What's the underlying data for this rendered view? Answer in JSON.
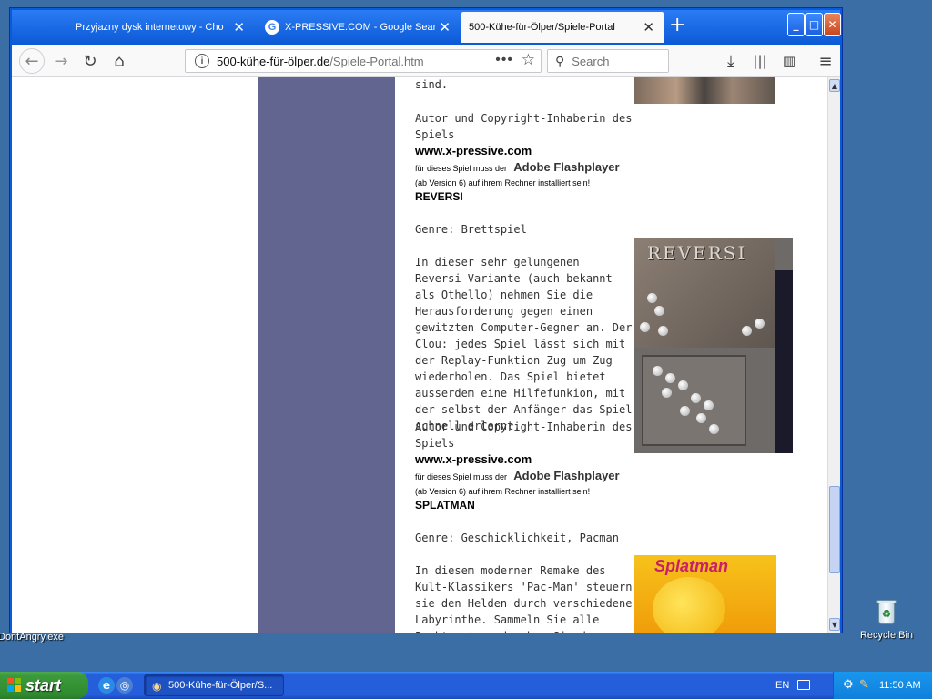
{
  "desktop": {
    "left_icon_label": "DontAngry.exe",
    "recycle_bin_label": "Recycle Bin"
  },
  "browser": {
    "tabs": [
      {
        "title": "Przyjazny dysk internetowy - Cho"
      },
      {
        "title": "X-PRESSIVE.COM - Google Search"
      },
      {
        "title": "500-Kühe-für-Ölper/Spiele-Portal"
      }
    ],
    "url_host": "500-kühe-für-ölper.de",
    "url_path": "/Spiele-Portal.htm",
    "search_placeholder": "Search"
  },
  "page": {
    "top_fragment": "sind.",
    "block1": {
      "author_line": "Autor und Copyright-Inhaberin des Spiels",
      "website": "www.x-pressive.com",
      "flash_prefix": "für dieses Spiel muss der",
      "flash_name": "Adobe Flashplayer",
      "flash_suffix": "(ab Version 6) auf ihrem Rechner installiert sein!"
    },
    "reversi": {
      "heading": "REVERSI",
      "genre": "Genre: Brettspiel",
      "description": "In dieser sehr gelungenen Reversi-Variante (auch bekannt als Othello) nehmen Sie die Herausforderung gegen einen gewitzten Computer-Gegner an. Der Clou: jedes Spiel lässt sich mit der Replay-Funktion Zug um Zug wiederholen. Das Spiel bietet ausserdem eine Hilfefunkion, mit der selbst der Anfänger das Spiel schnell erlernt.",
      "author_line": "Autor und Copyright-Inhaberin des Spiels",
      "website": "www.x-pressive.com",
      "flash_prefix": "für dieses Spiel muss der",
      "flash_name": "Adobe Flashplayer",
      "flash_suffix": "(ab Version 6) auf ihrem Rechner installiert sein!",
      "image_title": "REVERSI"
    },
    "splatman": {
      "heading": "SPLATMAN",
      "genre": "Genre: Geschicklichkeit, Pacman",
      "description": "In diesem modernen Remake des Kult-Klassikers 'Pac-Man' steuern sie den Helden durch verschiedene Labyrinthe. Sammeln Sie alle Punkte ein und gehen Sie den bösen Geistern möglichst aus",
      "image_title": "Splatman"
    }
  },
  "taskbar": {
    "start_label": "start",
    "task_label": "500-Kühe-für-Ölper/S...",
    "lang": "EN",
    "time": "11:50 AM"
  }
}
